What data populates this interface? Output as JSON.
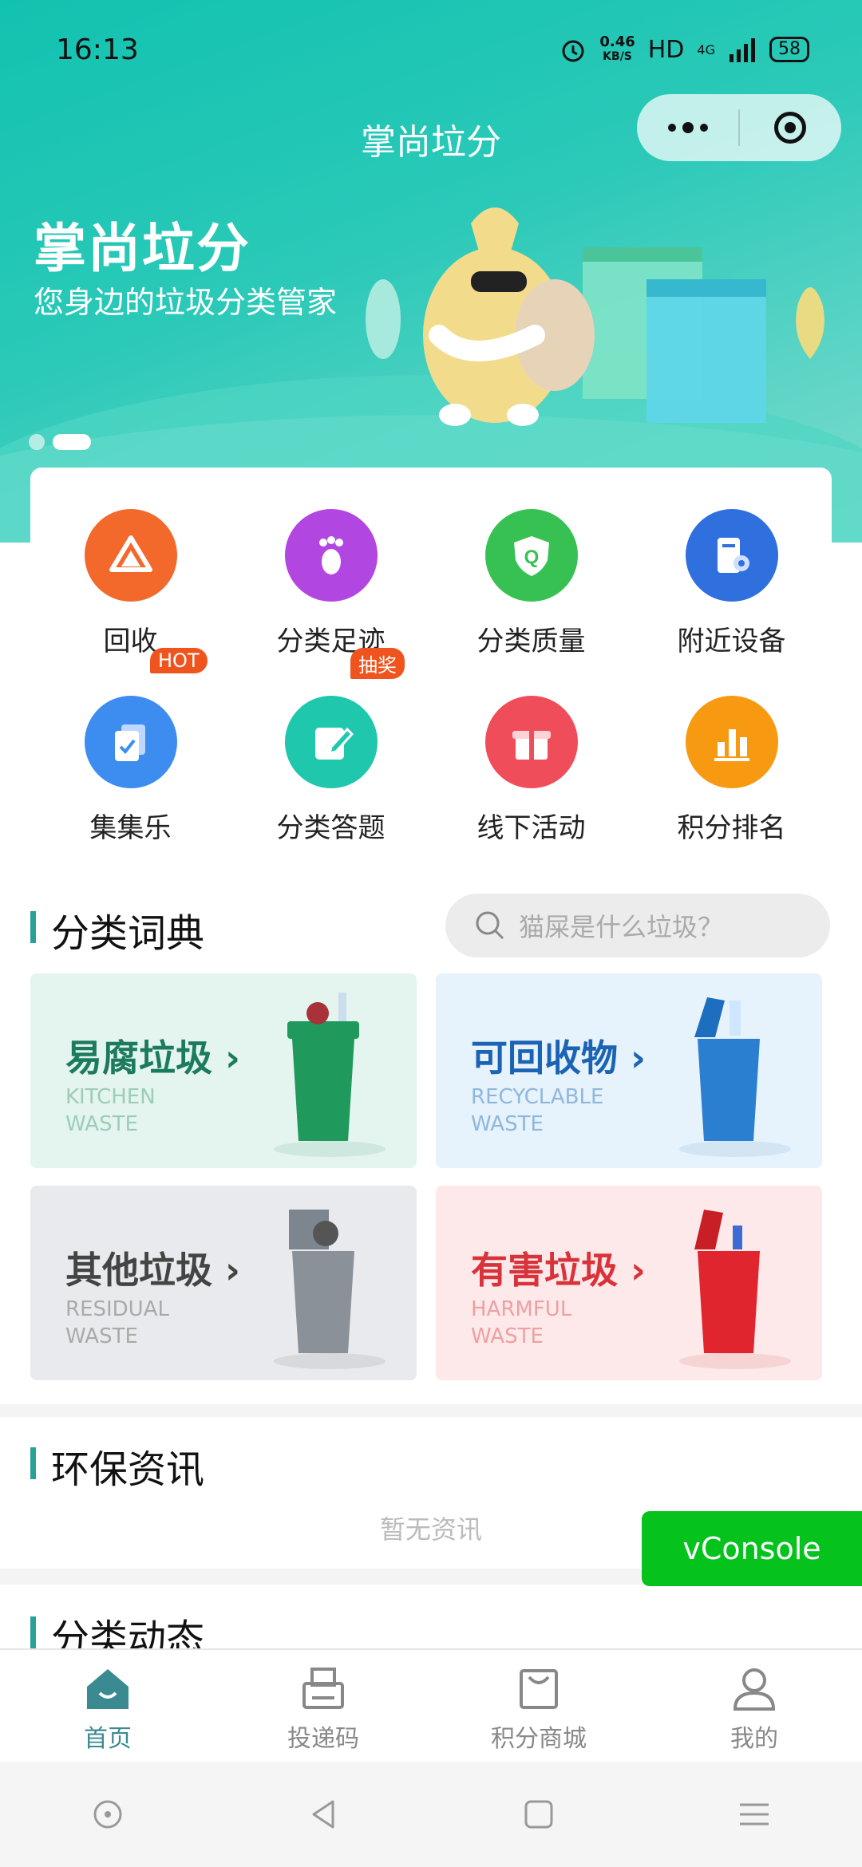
{
  "status_bar": {
    "time": "16:13",
    "net_speed": "0.46",
    "net_unit": "KB/S",
    "hd": "HD",
    "network": "4G",
    "battery": "58"
  },
  "nav": {
    "title": "掌尚垃分"
  },
  "banner": {
    "title": "掌尚垃分",
    "subtitle": "您身边的垃圾分类管家",
    "pages": 2,
    "active_page": 2
  },
  "grid": [
    {
      "label": "回收",
      "icon": "recycle-icon",
      "color": "#f2692b"
    },
    {
      "label": "分类足迹",
      "icon": "footprint-icon",
      "color": "#b246e0"
    },
    {
      "label": "分类质量",
      "icon": "quality-shield-icon",
      "color": "#38c153"
    },
    {
      "label": "附近设备",
      "icon": "device-location-icon",
      "color": "#2f6fde"
    },
    {
      "label": "集集乐",
      "icon": "collect-cards-icon",
      "color": "#3d8cf0",
      "badge": "HOT"
    },
    {
      "label": "分类答题",
      "icon": "quiz-edit-icon",
      "color": "#1fc7ad",
      "badge": "抽奖"
    },
    {
      "label": "线下活动",
      "icon": "gift-icon",
      "color": "#f04d5a"
    },
    {
      "label": "积分排名",
      "icon": "ranking-chart-icon",
      "color": "#f79a12"
    }
  ],
  "dictionary": {
    "title": "分类词典",
    "search_placeholder": "猫屎是什么垃圾？",
    "categories": [
      {
        "name": "易腐垃圾",
        "en1": "KITCHEN",
        "en2": "WASTE",
        "color": "#1c7a5d",
        "bg": "#e4f4ef",
        "bin": "#1f9a5c"
      },
      {
        "name": "可回收物",
        "en1": "RECYCLABLE",
        "en2": "WASTE",
        "color": "#1b63b3",
        "bg": "#e6f2fc",
        "bin": "#2a7fd0"
      },
      {
        "name": "其他垃圾",
        "en1": "RESIDUAL",
        "en2": "WASTE",
        "color": "#444444",
        "bg": "#e9eaed",
        "bin": "#8a9199"
      },
      {
        "name": "有害垃圾",
        "en1": "HARMFUL",
        "en2": "WASTE",
        "color": "#d8333b",
        "bg": "#fde9e9",
        "bin": "#e0252e"
      }
    ]
  },
  "news": {
    "title": "环保资讯",
    "empty": "暂无资讯"
  },
  "dynamics": {
    "title": "分类动态"
  },
  "vconsole": "vConsole",
  "tabbar": [
    {
      "label": "首页",
      "icon": "home-icon",
      "active": true
    },
    {
      "label": "投递码",
      "icon": "printer-code-icon",
      "active": false
    },
    {
      "label": "积分商城",
      "icon": "shopping-bag-icon",
      "active": false
    },
    {
      "label": "我的",
      "icon": "user-icon",
      "active": false
    }
  ]
}
